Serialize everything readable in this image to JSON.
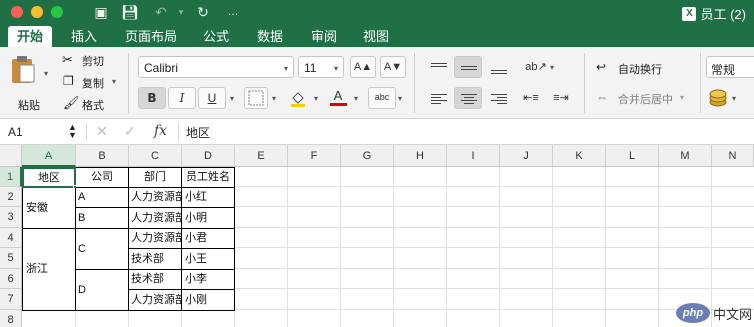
{
  "window": {
    "title": "员工 (2)"
  },
  "tabs": [
    "开始",
    "插入",
    "页面布局",
    "公式",
    "数据",
    "审阅",
    "视图"
  ],
  "ribbon": {
    "paste_label": "粘贴",
    "cut_label": "剪切",
    "copy_label": "复制",
    "format_label": "格式",
    "font_name": "Calibri",
    "font_size": "11",
    "bold": "B",
    "italic": "I",
    "underline": "U",
    "font_color_glyph": "A",
    "abc_glyph": "abc",
    "wrap_text_label": "自动换行",
    "merge_center_label": "合并后居中",
    "number_format": "常规",
    "grow_font_glyph": "A▲",
    "shrink_font_glyph": "A▼"
  },
  "formula_bar": {
    "name_box": "A1",
    "fx_label": "fx",
    "content": "地区"
  },
  "columns": [
    "A",
    "B",
    "C",
    "D",
    "E",
    "F",
    "G",
    "H",
    "I",
    "J",
    "K",
    "L",
    "M",
    "N"
  ],
  "rows": [
    "1",
    "2",
    "3",
    "4",
    "5",
    "6",
    "7",
    "8"
  ],
  "table": {
    "headers": [
      "地区",
      "公司",
      "部门",
      "员工姓名"
    ],
    "region_anhui": "安徽",
    "region_zhejiang": "浙江",
    "company_a": "A",
    "company_b": "B",
    "company_c": "C",
    "company_d": "D",
    "departments": [
      "人力资源部",
      "人力资源部",
      "人力资源部",
      "技术部",
      "技术部",
      "人力资源部"
    ],
    "names": [
      "小红",
      "小明",
      "小君",
      "小王",
      "小李",
      "小刚"
    ]
  },
  "watermark": {
    "logo": "php",
    "text": "中文网"
  }
}
